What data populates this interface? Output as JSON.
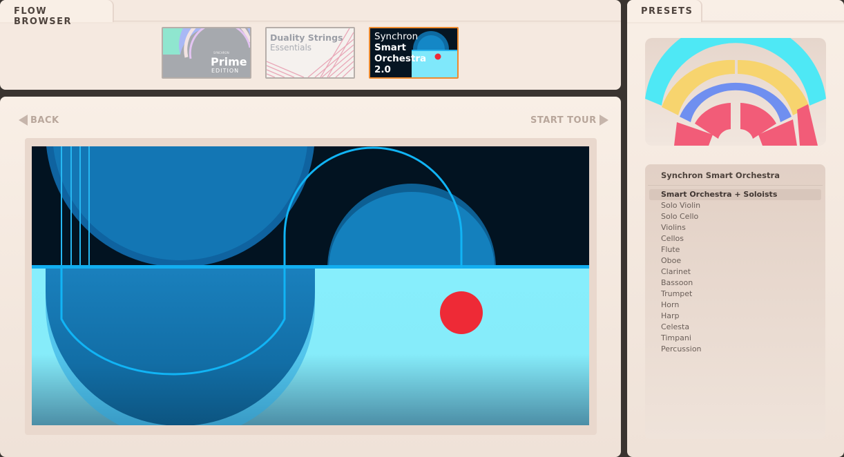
{
  "flow_browser": {
    "tab_label": "FLOW BROWSER",
    "thumbnails": [
      {
        "small_text": "SYNCHRON",
        "title": "Prime",
        "subtitle": "EDITION"
      },
      {
        "title": "Duality Strings",
        "subtitle": "Essentials"
      },
      {
        "lines": [
          "Synchron",
          "Smart",
          "Orchestra",
          "2.0"
        ],
        "selected": true
      }
    ]
  },
  "viewer": {
    "back_label": "BACK",
    "tour_label": "START TOUR"
  },
  "presets": {
    "tab_label": "PRESETS",
    "list_title": "Synchron Smart Orchestra",
    "items": [
      "Smart Orchestra + Soloists",
      "Solo Violin",
      "Solo Cello",
      "Violins",
      "Cellos",
      "Flute",
      "Oboe",
      "Clarinet",
      "Bassoon",
      "Trumpet",
      "Horn",
      "Harp",
      "Celesta",
      "Timpani",
      "Percussion"
    ],
    "active_index": 0
  },
  "colors": {
    "selected_border": "#ee8a2e",
    "seating_cyan": "#4ee8f5",
    "seating_yellow": "#f7d46e",
    "seating_blue": "#6f8ff0",
    "seating_red": "#f25c78",
    "accent_red": "#ee2a36"
  }
}
